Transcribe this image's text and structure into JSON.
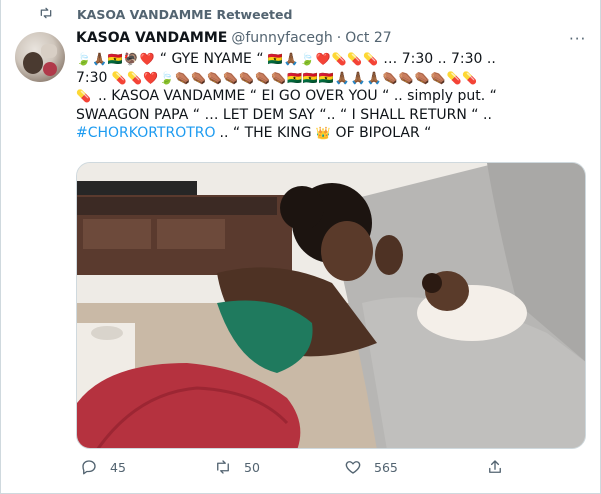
{
  "retweet": {
    "text": "KASOA VANDAMME Retweeted"
  },
  "tweet": {
    "name": "KASOA VANDAMME",
    "handle": "@funnyfacegh",
    "separator": "·",
    "date": "Oct 27",
    "more_label": "···",
    "lines": [
      {
        "pre": "",
        "quote": "“ GYE NYAME “",
        "post": "… 7:30 .. 7:30 .."
      },
      {
        "pre": "7:30",
        "quote": "",
        "post": ""
      },
      {
        "pre": "",
        "quote": "",
        "post": ".. KASOA VANDAMME  “ EI GO OVER YOU “  .. simply put. “"
      },
      {
        "pre": "SWAAGON PAPA “ … LET DEM SAY “.. “ I SHALL RETURN “ ..",
        "quote": "",
        "post": ""
      }
    ],
    "hashtag": "#CHORKORTROTRO",
    "line5_rest": ".. “ THE KING",
    "line5_end": "OF BIPOLAR “"
  },
  "emojis": {
    "line1a": [
      "🍃",
      "🙏🏾",
      "🇬🇭",
      "🦃",
      "❤️"
    ],
    "line1b": [
      "🇬🇭",
      "🙏🏾",
      "🍃",
      "❤️",
      "💊",
      "💊",
      "💊"
    ],
    "line2": [
      "💊",
      "💊",
      "❤️",
      "🍃",
      "⚰️",
      "⚰️",
      "⚰️",
      "⚰️",
      "⚰️",
      "⚰️",
      "⚰️",
      "🇬🇭",
      "🇬🇭",
      "🇬🇭",
      "🙏🏾",
      "🙏🏾",
      "🙏🏾",
      "⚰️",
      "⚰️",
      "⚰️",
      "⚰️",
      "💊",
      "💊"
    ],
    "line3": [
      "💊"
    ],
    "crown": "👑"
  },
  "actions": {
    "reply_count": "45",
    "retweet_count": "50",
    "like_count": "565"
  },
  "colors": {
    "accent": "#1d9bf0",
    "muted": "#536471",
    "text": "#0f1419"
  }
}
